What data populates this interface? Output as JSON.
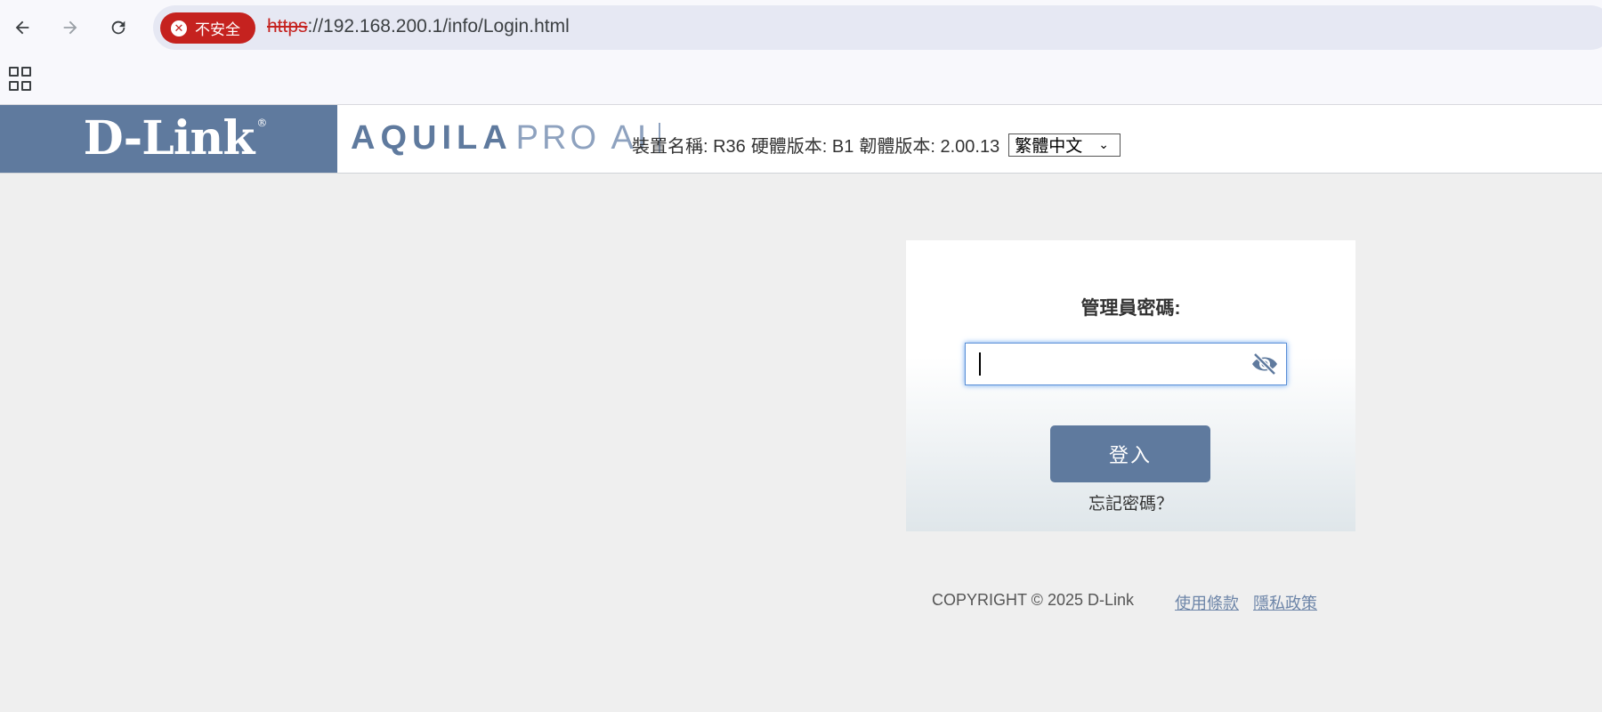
{
  "browser": {
    "security_label": "不安全",
    "url_scheme": "https",
    "url_rest": "://192.168.200.1/info/Login.html"
  },
  "header": {
    "brand": "D-Link",
    "registered": "®",
    "product_bold": "AQUILA",
    "product_light": "PRO AI",
    "device_name": "裝置名稱: R36",
    "hardware_version": "硬體版本: B1",
    "firmware_version": "韌體版本: 2.00.13",
    "language": "繁體中文"
  },
  "login": {
    "password_label": "管理員密碼:",
    "password_value": "",
    "login_button": "登入",
    "forgot_password": "忘記密碼？"
  },
  "footer": {
    "copyright": "COPYRIGHT © 2025 D-Link",
    "terms": "使用條款",
    "privacy": "隱私政策"
  },
  "colors": {
    "brand_blue": "#5f7a9e",
    "insecure_red": "#c5221f"
  }
}
